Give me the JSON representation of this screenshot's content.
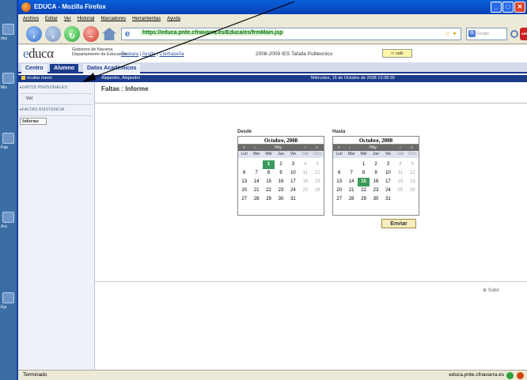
{
  "window": {
    "title": "EDUCA - Mozilla Firefox",
    "controls": [
      "_",
      "□",
      "✕"
    ]
  },
  "menubar": [
    "Archivo",
    "Editar",
    "Ver",
    "Historial",
    "Marcadores",
    "Herramientas",
    "Ayuda"
  ],
  "navbar": {
    "url": "https://educa.pnte.cfnavarra.es/Educa/es/frmMain.jsp",
    "search_placeholder": "Google"
  },
  "header": {
    "logo": "educa",
    "gov_line1": "Gobierno de Navarra",
    "gov_line2": "Departamento de Educación",
    "links": [
      "Euskara",
      "Ayuda",
      "Contraseña"
    ],
    "school": "2008-2009 IES Tafalla Politecnico",
    "salir": "salir"
  },
  "tabs": [
    {
      "label": "Centro",
      "active": false
    },
    {
      "label": "Alumno",
      "active": true
    },
    {
      "label": "Datos Académicos",
      "active": false
    }
  ],
  "bluebar": {
    "ocultar": "ocultar menú",
    "user": "Alejandre, Alejandro",
    "date": "Miércoles, 15 de Octubre de 2008   13:38:39"
  },
  "sidebar": {
    "section1": "DATOS PERSONALES",
    "section1_item": "Ver",
    "section2": "FALTAS ASISTENCIA",
    "section2_item": "Informe"
  },
  "main": {
    "title": "Faltas : Informe",
    "desde_label": "Desde",
    "hasta_label": "Hasta",
    "enviar": "Enviar",
    "subir": "Subir"
  },
  "calendar": {
    "month": "Octubre, 2008",
    "hoy": "Hoy",
    "nav": [
      "«",
      "‹",
      "›",
      "»"
    ],
    "dow": [
      "Lun",
      "Mar",
      "Mié",
      "Jue",
      "Vie",
      "Sáb",
      "Dom"
    ],
    "weeks": [
      [
        "",
        "",
        "1",
        "2",
        "3",
        "4",
        "5"
      ],
      [
        "6",
        "7",
        "8",
        "9",
        "10",
        "11",
        "12"
      ],
      [
        "13",
        "14",
        "15",
        "16",
        "17",
        "18",
        "19"
      ],
      [
        "20",
        "21",
        "22",
        "23",
        "24",
        "25",
        "26"
      ],
      [
        "27",
        "28",
        "29",
        "30",
        "31",
        "",
        ""
      ]
    ],
    "desde_selected": "1",
    "hasta_selected": "15"
  },
  "statusbar": {
    "left": "Terminado",
    "right": "educa.pnte.cfnavarra.es"
  },
  "desktop": {
    "labels": [
      "doc",
      "Mis",
      "Pap",
      "Acc",
      "Eja"
    ]
  }
}
